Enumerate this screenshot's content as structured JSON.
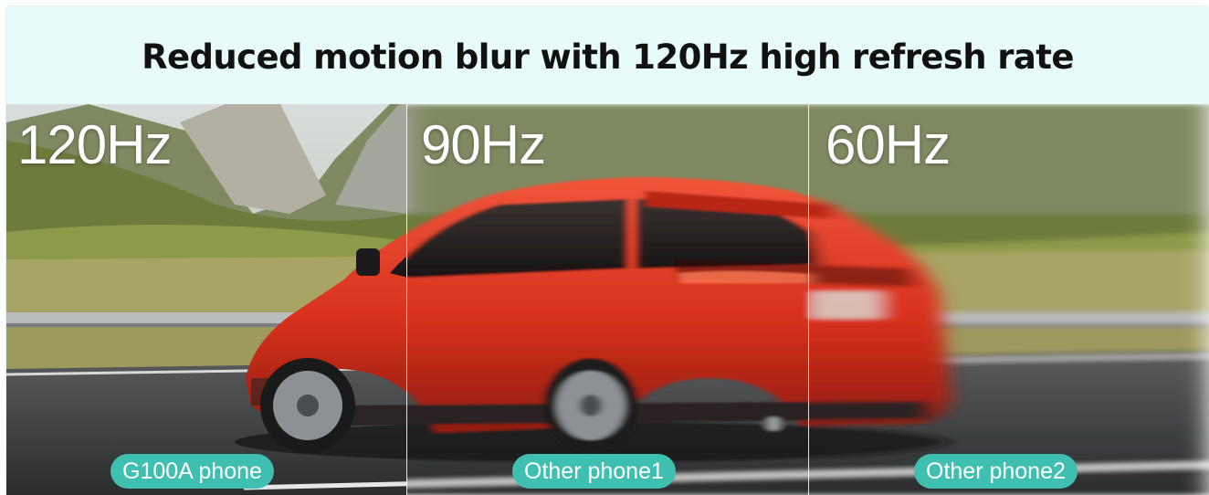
{
  "title": "Reduced motion blur with 120Hz high refresh rate",
  "panels": [
    {
      "rate": "120Hz",
      "device": "G100A phone"
    },
    {
      "rate": "90Hz",
      "device": "Other phone1"
    },
    {
      "rate": "60Hz",
      "device": "Other phone2"
    }
  ],
  "colors": {
    "header_bg": "#e8fbfb",
    "pill": "#3fbfb0",
    "car": "#e3361f"
  }
}
